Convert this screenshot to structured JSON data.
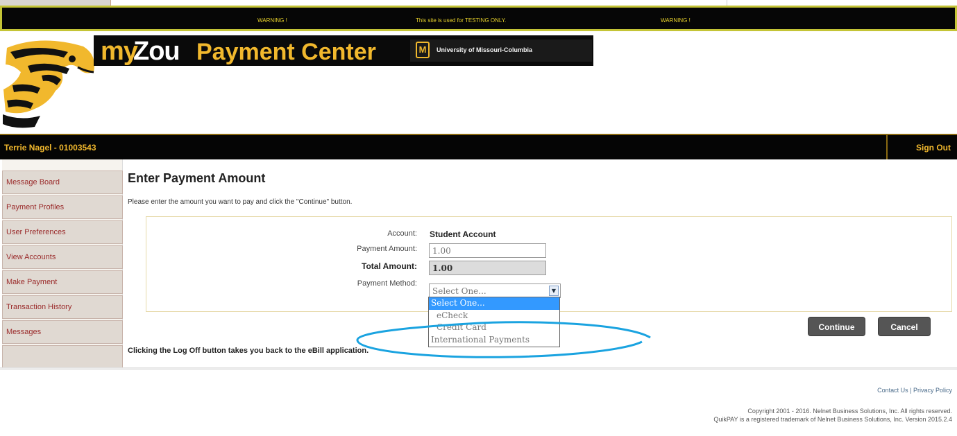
{
  "warning": {
    "left": "WARNING !",
    "center": "This site is used for TESTING ONLY.",
    "right": "WARNING !"
  },
  "brand": {
    "my": "my",
    "zou": "Zou",
    "center": "Payment Center",
    "university_logo": "M",
    "university": "University of Missouri-Columbia"
  },
  "userbar": {
    "user": "Terrie Nagel - 01003543",
    "signout": "Sign Out"
  },
  "sidebar": {
    "items": [
      {
        "label": "Message Board"
      },
      {
        "label": "Payment Profiles"
      },
      {
        "label": "User Preferences"
      },
      {
        "label": "View Accounts"
      },
      {
        "label": "Make Payment"
      },
      {
        "label": "Transaction History"
      },
      {
        "label": "Messages"
      }
    ]
  },
  "main": {
    "title": "Enter Payment Amount",
    "instructions": "Please enter the amount you want to pay and click the \"Continue\" button.",
    "form": {
      "account_label": "Account:",
      "account_value": "Student Account",
      "payment_amount_label": "Payment Amount:",
      "payment_amount_value": "1.00",
      "total_amount_label": "Total Amount:",
      "total_amount_value": "1.00",
      "payment_method_label": "Payment Method:",
      "payment_method_value": "Select One...",
      "payment_method_options": [
        "Select One...",
        "eCheck",
        "Credit Card",
        "International Payments"
      ]
    },
    "continue_label": "Continue",
    "cancel_label": "Cancel",
    "logoff_note": "Clicking the Log Off button takes you back to the eBill application."
  },
  "footer": {
    "contact": "Contact Us",
    "separator": "|",
    "privacy": "Privacy Policy",
    "copyright_line1": "Copyright 2001 - 2016. Nelnet Business Solutions, Inc. All rights reserved.",
    "copyright_line2": "QuikPAY is a registered trademark of Nelnet Business Solutions, Inc. Version 2015.2.4"
  },
  "colors": {
    "gold": "#f1b82d",
    "black": "#050505",
    "nav_text": "#9a2b2b",
    "annotation": "#1aa3e0"
  },
  "icons": {
    "dropdown_arrow": "chevron-down-icon",
    "tiger": "tiger-mascot-icon"
  }
}
